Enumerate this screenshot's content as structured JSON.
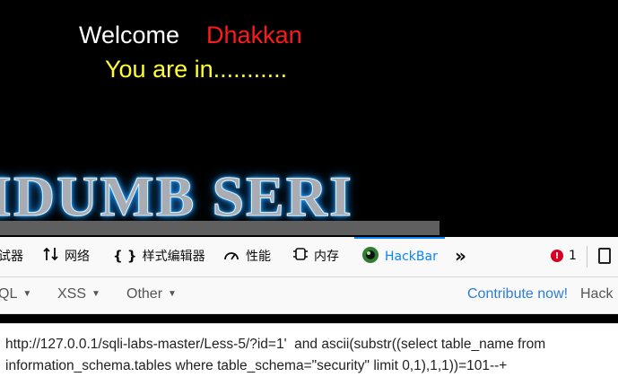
{
  "page": {
    "welcome": "Welcome",
    "user": "Dhakkan",
    "status": "You are in...........",
    "banner": "IDUMB SERI"
  },
  "devtools": {
    "tabs": [
      {
        "label": "试器",
        "icon": ""
      },
      {
        "label": "网络",
        "icon": "network-arrows-icon"
      },
      {
        "label": "样式编辑器",
        "icon": "braces-icon"
      },
      {
        "label": "性能",
        "icon": "gauge-icon"
      },
      {
        "label": "内存",
        "icon": "memory-chip-icon"
      },
      {
        "label": "HackBar",
        "icon": "hackbar-logo-icon"
      }
    ],
    "more_icon": "double-chevron-right-icon",
    "error_count": "1",
    "error_icon": "!"
  },
  "hackbar": {
    "menus": [
      "QL",
      "XSS",
      "Other"
    ],
    "contribute": "Contribute now!",
    "brand": "Hack",
    "url_line1": "http://127.0.0.1/sqli-labs-master/Less-5/?id=1'  and ascii(substr((select table_name from",
    "url_line2": "information_schema.tables where table_schema=\"security\" limit 0,1),1,1))=101--+"
  },
  "colors": {
    "accent": "#0a84ff",
    "error": "#d70022",
    "username": "#ff1a1a",
    "status": "#ffff33"
  }
}
